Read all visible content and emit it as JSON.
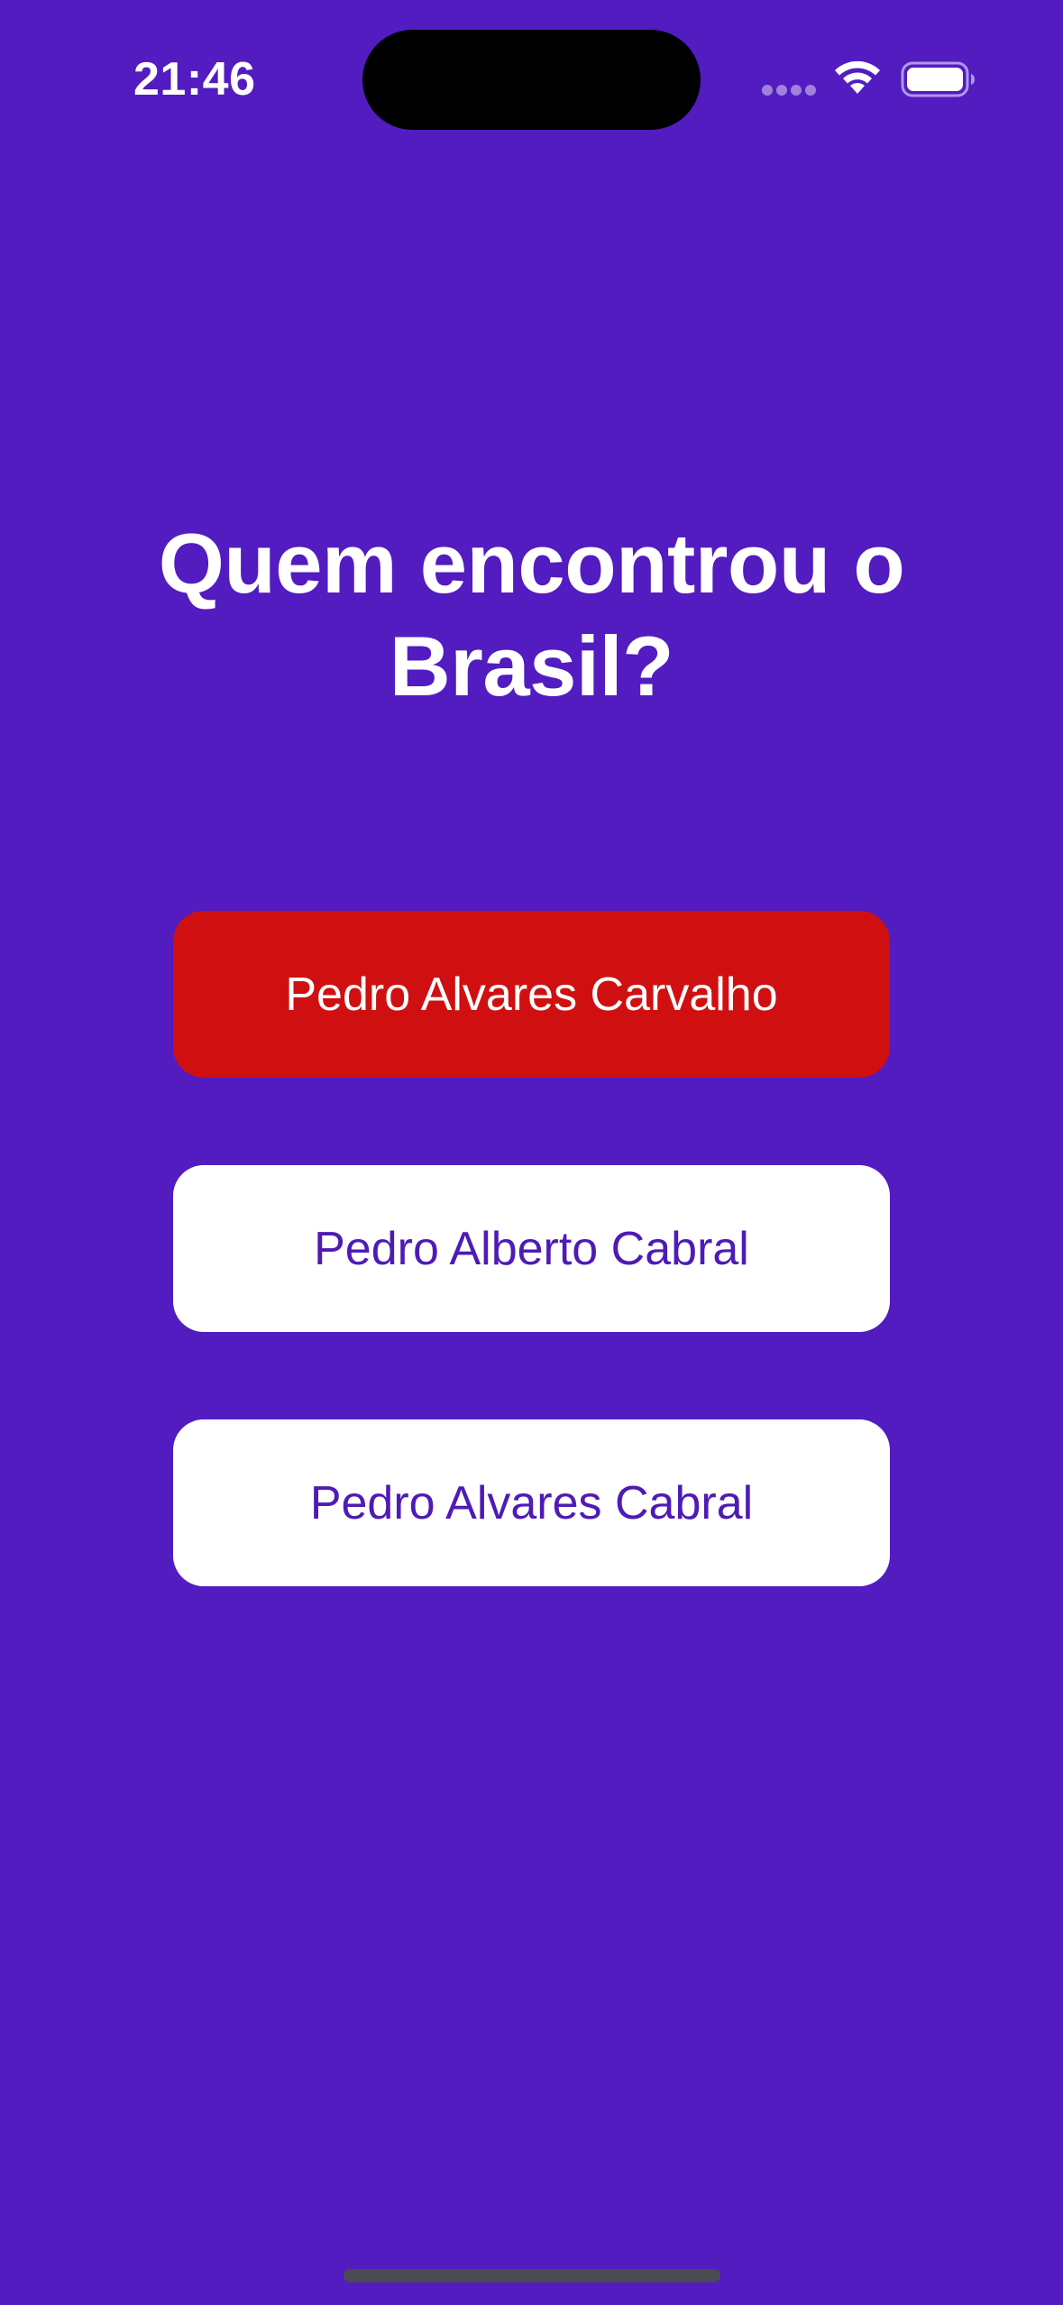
{
  "status_bar": {
    "time": "21:46",
    "icons": [
      "signal-dots-icon",
      "wifi-icon",
      "battery-icon"
    ]
  },
  "question": {
    "title": "Quem encontrou o Brasil?"
  },
  "answers": [
    {
      "label": "Pedro Alvares Carvalho",
      "state": "wrong"
    },
    {
      "label": "Pedro Alberto Cabral",
      "state": "default"
    },
    {
      "label": "Pedro Alvares Cabral",
      "state": "default"
    }
  ],
  "colors": {
    "background": "#521cc0",
    "wrong_answer": "#d01010",
    "answer_default_bg": "#ffffff",
    "answer_default_text": "#4e1bb5"
  }
}
